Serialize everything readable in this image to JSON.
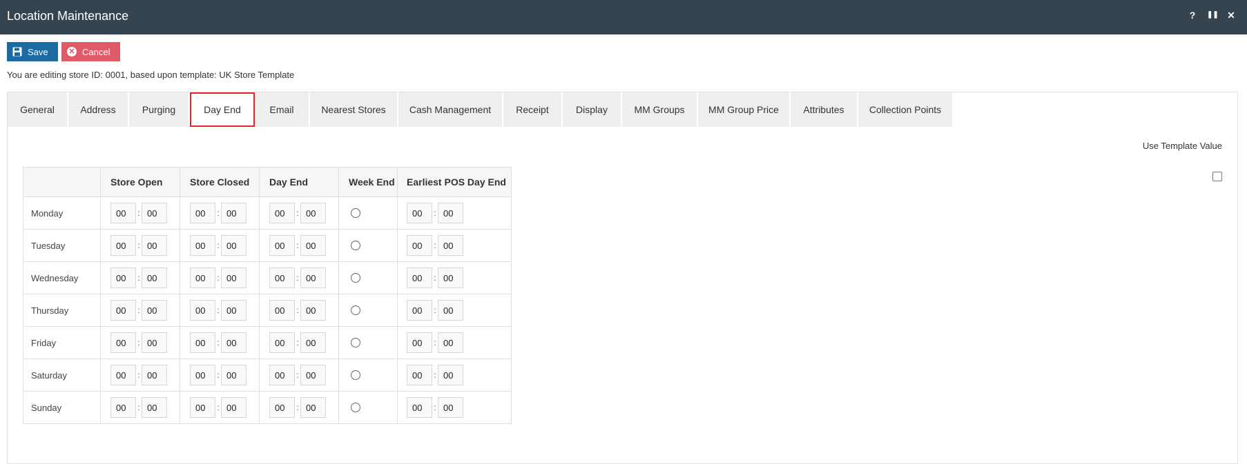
{
  "window": {
    "title": "Location Maintenance",
    "help_icon": "?",
    "pause_icon": "❚❚",
    "close_icon": "✕"
  },
  "toolbar": {
    "save_label": "Save",
    "cancel_label": "Cancel"
  },
  "info_text": "You are editing store ID: 0001, based upon template: UK Store Template",
  "tabs": [
    {
      "label": "General"
    },
    {
      "label": "Address"
    },
    {
      "label": "Purging"
    },
    {
      "label": "Day End"
    },
    {
      "label": "Email"
    },
    {
      "label": "Nearest Stores"
    },
    {
      "label": "Cash Management"
    },
    {
      "label": "Receipt"
    },
    {
      "label": "Display"
    },
    {
      "label": "MM Groups"
    },
    {
      "label": "MM Group Price"
    },
    {
      "label": "Attributes"
    },
    {
      "label": "Collection Points"
    }
  ],
  "active_tab": "Day End",
  "use_template_label": "Use Template Value",
  "use_template_checked": false,
  "table": {
    "headers": [
      "",
      "Store Open",
      "Store Closed",
      "Day End",
      "Week End",
      "Earliest POS Day End"
    ],
    "rows": [
      {
        "day": "Monday",
        "open_h": "00",
        "open_m": "00",
        "closed_h": "00",
        "closed_m": "00",
        "dayend_h": "00",
        "dayend_m": "00",
        "pos_h": "00",
        "pos_m": "00"
      },
      {
        "day": "Tuesday",
        "open_h": "00",
        "open_m": "00",
        "closed_h": "00",
        "closed_m": "00",
        "dayend_h": "00",
        "dayend_m": "00",
        "pos_h": "00",
        "pos_m": "00"
      },
      {
        "day": "Wednesday",
        "open_h": "00",
        "open_m": "00",
        "closed_h": "00",
        "closed_m": "00",
        "dayend_h": "00",
        "dayend_m": "00",
        "pos_h": "00",
        "pos_m": "00"
      },
      {
        "day": "Thursday",
        "open_h": "00",
        "open_m": "00",
        "closed_h": "00",
        "closed_m": "00",
        "dayend_h": "00",
        "dayend_m": "00",
        "pos_h": "00",
        "pos_m": "00"
      },
      {
        "day": "Friday",
        "open_h": "00",
        "open_m": "00",
        "closed_h": "00",
        "closed_m": "00",
        "dayend_h": "00",
        "dayend_m": "00",
        "pos_h": "00",
        "pos_m": "00"
      },
      {
        "day": "Saturday",
        "open_h": "00",
        "open_m": "00",
        "closed_h": "00",
        "closed_m": "00",
        "dayend_h": "00",
        "dayend_m": "00",
        "pos_h": "00",
        "pos_m": "00"
      },
      {
        "day": "Sunday",
        "open_h": "00",
        "open_m": "00",
        "closed_h": "00",
        "closed_m": "00",
        "dayend_h": "00",
        "dayend_m": "00",
        "pos_h": "00",
        "pos_m": "00"
      }
    ],
    "time_separator": ":"
  },
  "colors": {
    "titlebar_bg": "#35444f",
    "save_bg": "#1c6aa3",
    "cancel_bg": "#e05a68",
    "active_tab_border": "#e8232b",
    "tab_bg": "#efefef"
  }
}
